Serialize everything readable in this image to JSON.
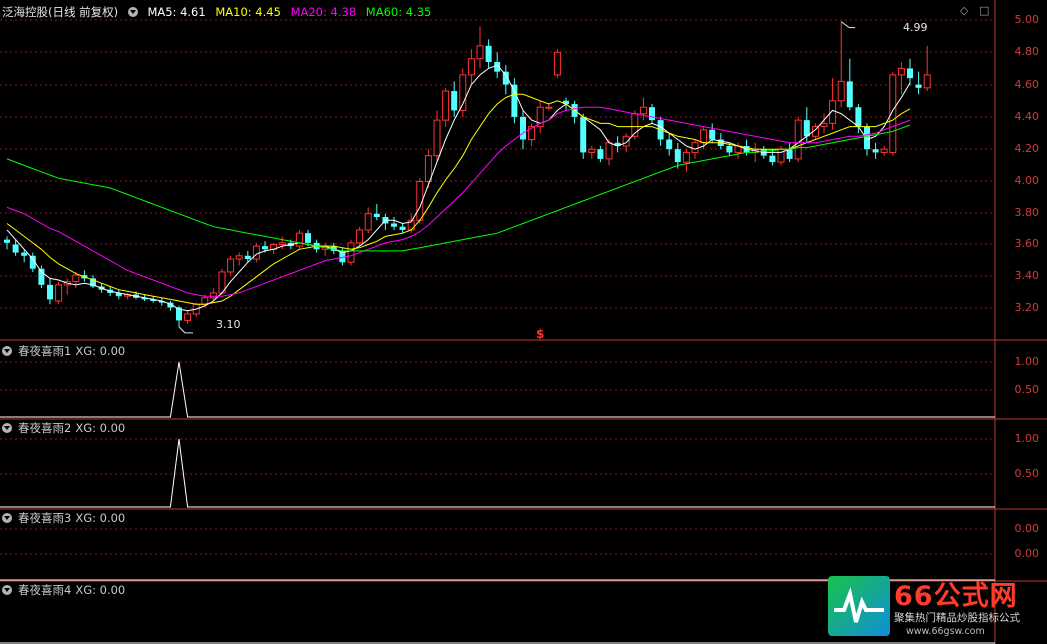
{
  "main": {
    "title": "泛海控股(日线 前复权)",
    "ma_labels": [
      {
        "label": "MA5: 4.61",
        "color": "#ffffff"
      },
      {
        "label": "MA10: 4.45",
        "color": "#ffff00"
      },
      {
        "label": "MA20: 4.38",
        "color": "#ff00ff"
      },
      {
        "label": "MA60: 4.35",
        "color": "#00ff00"
      }
    ],
    "high_label": "4.99",
    "low_label": "3.10",
    "signal_marker": "$",
    "y_ticks": [
      "5.00",
      "4.80",
      "4.60",
      "4.40",
      "4.20",
      "4.00",
      "3.80",
      "3.60",
      "3.40",
      "3.20"
    ]
  },
  "panels": [
    {
      "title": "春夜喜雨1",
      "value_label": "XG: 0.00",
      "ticks": [
        "1.00",
        "0.50"
      ]
    },
    {
      "title": "春夜喜雨2",
      "value_label": "XG: 0.00",
      "ticks": [
        "1.00",
        "0.50"
      ]
    },
    {
      "title": "春夜喜雨3",
      "value_label": "XG: 0.00",
      "ticks": [
        "0.00",
        "0.00"
      ]
    },
    {
      "title": "春夜喜雨4",
      "value_label": "XG: 0.00",
      "ticks": []
    }
  ],
  "window_icons": [
    "diamond-icon",
    "square-icon"
  ],
  "watermark": {
    "title": "66公式网",
    "subtitle": "聚集热门精品炒股指标公式",
    "url": "www.66gsw.com"
  },
  "colors": {
    "up": "#ff3232",
    "down": "#54ffff",
    "grid": "#8b1a1a",
    "axis": "#c83232",
    "ma5": "#ffffff",
    "ma10": "#ffff00",
    "ma20": "#ff00ff",
    "ma60": "#00ff00"
  },
  "chart_data": [
    {
      "type": "candlestick",
      "title": "泛海控股(日线 前复权)",
      "ylim": [
        3.05,
        5.05
      ],
      "ohlc": [
        [
          3.64,
          3.66,
          3.58,
          3.62
        ],
        [
          3.61,
          3.64,
          3.54,
          3.56
        ],
        [
          3.56,
          3.58,
          3.5,
          3.54
        ],
        [
          3.54,
          3.56,
          3.44,
          3.46
        ],
        [
          3.46,
          3.48,
          3.34,
          3.36
        ],
        [
          3.36,
          3.4,
          3.24,
          3.27
        ],
        [
          3.26,
          3.38,
          3.24,
          3.36
        ],
        [
          3.36,
          3.4,
          3.3,
          3.38
        ],
        [
          3.38,
          3.44,
          3.34,
          3.42
        ],
        [
          3.42,
          3.45,
          3.38,
          3.4
        ],
        [
          3.4,
          3.42,
          3.34,
          3.35
        ],
        [
          3.35,
          3.37,
          3.31,
          3.33
        ],
        [
          3.33,
          3.35,
          3.29,
          3.31
        ],
        [
          3.31,
          3.33,
          3.27,
          3.29
        ],
        [
          3.29,
          3.31,
          3.27,
          3.3
        ],
        [
          3.3,
          3.32,
          3.27,
          3.28
        ],
        [
          3.28,
          3.3,
          3.26,
          3.27
        ],
        [
          3.27,
          3.29,
          3.25,
          3.26
        ],
        [
          3.26,
          3.28,
          3.23,
          3.25
        ],
        [
          3.25,
          3.26,
          3.2,
          3.22
        ],
        [
          3.22,
          3.23,
          3.1,
          3.14
        ],
        [
          3.14,
          3.2,
          3.12,
          3.18
        ],
        [
          3.18,
          3.25,
          3.16,
          3.24
        ],
        [
          3.24,
          3.3,
          3.22,
          3.28
        ],
        [
          3.28,
          3.34,
          3.26,
          3.31
        ],
        [
          3.31,
          3.46,
          3.3,
          3.44
        ],
        [
          3.44,
          3.54,
          3.42,
          3.52
        ],
        [
          3.52,
          3.56,
          3.48,
          3.54
        ],
        [
          3.54,
          3.57,
          3.5,
          3.52
        ],
        [
          3.52,
          3.62,
          3.5,
          3.6
        ],
        [
          3.6,
          3.63,
          3.56,
          3.58
        ],
        [
          3.58,
          3.62,
          3.55,
          3.61
        ],
        [
          3.61,
          3.66,
          3.58,
          3.62
        ],
        [
          3.62,
          3.64,
          3.58,
          3.6
        ],
        [
          3.6,
          3.7,
          3.58,
          3.68
        ],
        [
          3.68,
          3.7,
          3.6,
          3.62
        ],
        [
          3.62,
          3.64,
          3.56,
          3.58
        ],
        [
          3.58,
          3.62,
          3.54,
          3.6
        ],
        [
          3.6,
          3.62,
          3.55,
          3.57
        ],
        [
          3.57,
          3.59,
          3.48,
          3.5
        ],
        [
          3.5,
          3.64,
          3.48,
          3.62
        ],
        [
          3.62,
          3.72,
          3.6,
          3.7
        ],
        [
          3.7,
          3.84,
          3.68,
          3.8
        ],
        [
          3.8,
          3.86,
          3.76,
          3.78
        ],
        [
          3.78,
          3.8,
          3.7,
          3.74
        ],
        [
          3.74,
          3.78,
          3.7,
          3.72
        ],
        [
          3.72,
          3.74,
          3.68,
          3.7
        ],
        [
          3.7,
          3.8,
          3.68,
          3.76
        ],
        [
          3.76,
          4.02,
          3.74,
          4.0
        ],
        [
          4.0,
          4.2,
          3.96,
          4.16
        ],
        [
          4.16,
          4.44,
          4.12,
          4.38
        ],
        [
          4.38,
          4.58,
          4.34,
          4.56
        ],
        [
          4.56,
          4.62,
          4.4,
          4.44
        ],
        [
          4.44,
          4.7,
          4.4,
          4.66
        ],
        [
          4.66,
          4.82,
          4.6,
          4.76
        ],
        [
          4.76,
          4.96,
          4.7,
          4.84
        ],
        [
          4.84,
          4.88,
          4.7,
          4.74
        ],
        [
          4.74,
          4.8,
          4.64,
          4.68
        ],
        [
          4.68,
          4.72,
          4.54,
          4.6
        ],
        [
          4.6,
          4.64,
          4.36,
          4.4
        ],
        [
          4.4,
          4.44,
          4.2,
          4.26
        ],
        [
          4.26,
          4.36,
          4.22,
          4.34
        ],
        [
          4.34,
          4.5,
          4.3,
          4.46
        ],
        [
          4.46,
          4.48,
          4.44,
          4.46
        ],
        [
          4.66,
          4.82,
          4.64,
          4.8
        ],
        [
          4.5,
          4.52,
          4.44,
          4.48
        ],
        [
          4.48,
          4.5,
          4.36,
          4.4
        ],
        [
          4.4,
          4.42,
          4.14,
          4.18
        ],
        [
          4.18,
          4.22,
          4.14,
          4.2
        ],
        [
          4.2,
          4.22,
          4.12,
          4.14
        ],
        [
          4.14,
          4.26,
          4.1,
          4.24
        ],
        [
          4.24,
          4.28,
          4.18,
          4.22
        ],
        [
          4.22,
          4.3,
          4.18,
          4.28
        ],
        [
          4.28,
          4.44,
          4.26,
          4.42
        ],
        [
          4.42,
          4.52,
          4.38,
          4.46
        ],
        [
          4.46,
          4.48,
          4.36,
          4.38
        ],
        [
          4.38,
          4.4,
          4.22,
          4.26
        ],
        [
          4.26,
          4.3,
          4.16,
          4.2
        ],
        [
          4.2,
          4.24,
          4.08,
          4.12
        ],
        [
          4.12,
          4.2,
          4.06,
          4.18
        ],
        [
          4.18,
          4.26,
          4.14,
          4.24
        ],
        [
          4.24,
          4.34,
          4.2,
          4.32
        ],
        [
          4.32,
          4.36,
          4.24,
          4.26
        ],
        [
          4.26,
          4.3,
          4.2,
          4.22
        ],
        [
          4.22,
          4.24,
          4.16,
          4.18
        ],
        [
          4.18,
          4.24,
          4.14,
          4.22
        ],
        [
          4.22,
          4.26,
          4.16,
          4.18
        ],
        [
          4.18,
          4.24,
          4.12,
          4.2
        ],
        [
          4.2,
          4.22,
          4.14,
          4.16
        ],
        [
          4.16,
          4.2,
          4.1,
          4.12
        ],
        [
          4.12,
          4.22,
          4.1,
          4.2
        ],
        [
          4.2,
          4.24,
          4.12,
          4.14
        ],
        [
          4.14,
          4.4,
          4.12,
          4.38
        ],
        [
          4.38,
          4.46,
          4.24,
          4.28
        ],
        [
          4.28,
          4.36,
          4.26,
          4.34
        ],
        [
          4.34,
          4.42,
          4.3,
          4.36
        ],
        [
          4.36,
          4.64,
          4.32,
          4.5
        ],
        [
          4.5,
          4.99,
          4.46,
          4.62
        ],
        [
          4.62,
          4.76,
          4.44,
          4.46
        ],
        [
          4.46,
          4.48,
          4.3,
          4.34
        ],
        [
          4.34,
          4.36,
          4.16,
          4.2
        ],
        [
          4.2,
          4.24,
          4.14,
          4.18
        ],
        [
          4.18,
          4.22,
          4.16,
          4.2
        ],
        [
          4.18,
          4.68,
          4.16,
          4.66
        ],
        [
          4.66,
          4.74,
          4.54,
          4.7
        ],
        [
          4.7,
          4.76,
          4.6,
          4.64
        ],
        [
          4.6,
          4.68,
          4.54,
          4.58
        ],
        [
          4.58,
          4.84,
          4.56,
          4.66
        ]
      ],
      "ma": {
        "MA5": [
          3.7,
          3.64,
          3.58,
          3.52,
          3.44,
          3.4,
          3.39,
          3.37,
          3.36,
          3.37,
          3.36,
          3.34,
          3.32,
          3.31,
          3.3,
          3.29,
          3.28,
          3.27,
          3.26,
          3.24,
          3.21,
          3.2,
          3.21,
          3.23,
          3.26,
          3.31,
          3.38,
          3.44,
          3.5,
          3.55,
          3.57,
          3.58,
          3.6,
          3.61,
          3.62,
          3.61,
          3.6,
          3.6,
          3.58,
          3.56,
          3.57,
          3.6,
          3.64,
          3.7,
          3.76,
          3.76,
          3.74,
          3.75,
          3.84,
          3.98,
          4.12,
          4.26,
          4.38,
          4.48,
          4.6,
          4.66,
          4.7,
          4.72,
          4.66,
          4.56,
          4.44,
          4.38,
          4.36,
          4.38,
          4.44,
          4.48,
          4.44,
          4.4,
          4.36,
          4.32,
          4.24,
          4.22,
          4.24,
          4.3,
          4.34,
          4.36,
          4.34,
          4.3,
          4.26,
          4.22,
          4.2,
          4.22,
          4.26,
          4.25,
          4.24,
          4.22,
          4.2,
          4.19,
          4.18,
          4.18,
          4.18,
          4.2,
          4.24,
          4.28,
          4.32,
          4.38,
          4.44,
          4.42,
          4.38,
          4.34,
          4.26,
          4.28,
          4.34,
          4.44,
          4.52,
          4.61
        ],
        "MA10": [
          3.74,
          3.7,
          3.66,
          3.62,
          3.58,
          3.53,
          3.49,
          3.46,
          3.43,
          3.41,
          3.39,
          3.37,
          3.35,
          3.33,
          3.32,
          3.31,
          3.3,
          3.29,
          3.28,
          3.27,
          3.26,
          3.25,
          3.24,
          3.24,
          3.25,
          3.26,
          3.29,
          3.33,
          3.37,
          3.41,
          3.45,
          3.49,
          3.52,
          3.55,
          3.58,
          3.59,
          3.6,
          3.6,
          3.6,
          3.59,
          3.58,
          3.59,
          3.61,
          3.63,
          3.66,
          3.67,
          3.68,
          3.7,
          3.76,
          3.84,
          3.93,
          4.01,
          4.08,
          4.16,
          4.26,
          4.34,
          4.42,
          4.48,
          4.52,
          4.54,
          4.54,
          4.52,
          4.5,
          4.48,
          4.5,
          4.48,
          4.44,
          4.4,
          4.38,
          4.36,
          4.36,
          4.34,
          4.34,
          4.34,
          4.34,
          4.34,
          4.32,
          4.3,
          4.28,
          4.27,
          4.26,
          4.24,
          4.24,
          4.24,
          4.23,
          4.22,
          4.21,
          4.2,
          4.2,
          4.2,
          4.2,
          4.2,
          4.22,
          4.24,
          4.26,
          4.28,
          4.3,
          4.32,
          4.34,
          4.34,
          4.34,
          4.34,
          4.36,
          4.38,
          4.42,
          4.45
        ],
        "MA20": [
          3.84,
          3.82,
          3.8,
          3.77,
          3.74,
          3.71,
          3.69,
          3.66,
          3.63,
          3.6,
          3.57,
          3.54,
          3.51,
          3.48,
          3.45,
          3.43,
          3.41,
          3.39,
          3.37,
          3.35,
          3.33,
          3.31,
          3.3,
          3.29,
          3.29,
          3.29,
          3.3,
          3.31,
          3.33,
          3.35,
          3.37,
          3.39,
          3.41,
          3.43,
          3.45,
          3.47,
          3.49,
          3.51,
          3.52,
          3.53,
          3.54,
          3.56,
          3.58,
          3.6,
          3.62,
          3.63,
          3.64,
          3.66,
          3.69,
          3.73,
          3.78,
          3.83,
          3.88,
          3.93,
          3.99,
          4.05,
          4.11,
          4.17,
          4.22,
          4.26,
          4.3,
          4.33,
          4.36,
          4.38,
          4.42,
          4.44,
          4.45,
          4.46,
          4.46,
          4.46,
          4.45,
          4.44,
          4.43,
          4.42,
          4.41,
          4.4,
          4.39,
          4.38,
          4.37,
          4.36,
          4.35,
          4.34,
          4.33,
          4.32,
          4.31,
          4.3,
          4.29,
          4.28,
          4.27,
          4.26,
          4.25,
          4.24,
          4.24,
          4.24,
          4.24,
          4.25,
          4.26,
          4.27,
          4.28,
          4.28,
          4.29,
          4.3,
          4.32,
          4.34,
          4.36,
          4.38
        ],
        "MA60": [
          4.14,
          4.12,
          4.1,
          4.08,
          4.06,
          4.04,
          4.02,
          4.01,
          4.0,
          3.99,
          3.98,
          3.97,
          3.96,
          3.94,
          3.92,
          3.9,
          3.88,
          3.86,
          3.84,
          3.82,
          3.8,
          3.78,
          3.76,
          3.74,
          3.72,
          3.71,
          3.7,
          3.69,
          3.68,
          3.67,
          3.66,
          3.65,
          3.64,
          3.63,
          3.62,
          3.61,
          3.6,
          3.59,
          3.58,
          3.57,
          3.57,
          3.57,
          3.57,
          3.57,
          3.57,
          3.57,
          3.57,
          3.58,
          3.59,
          3.6,
          3.61,
          3.62,
          3.63,
          3.64,
          3.65,
          3.66,
          3.67,
          3.68,
          3.7,
          3.72,
          3.74,
          3.76,
          3.78,
          3.8,
          3.82,
          3.84,
          3.86,
          3.88,
          3.9,
          3.92,
          3.94,
          3.96,
          3.98,
          4.0,
          4.02,
          4.04,
          4.06,
          4.08,
          4.1,
          4.11,
          4.12,
          4.13,
          4.14,
          4.15,
          4.16,
          4.17,
          4.18,
          4.18,
          4.19,
          4.19,
          4.2,
          4.2,
          4.21,
          4.21,
          4.22,
          4.23,
          4.24,
          4.25,
          4.26,
          4.27,
          4.28,
          4.29,
          4.3,
          4.31,
          4.33,
          4.35
        ]
      }
    },
    {
      "type": "line",
      "title": "春夜喜雨1",
      "ylim": [
        0,
        1.1
      ],
      "spike_index": 20,
      "value": 1.0
    },
    {
      "type": "line",
      "title": "春夜喜雨2",
      "ylim": [
        0,
        1.1
      ],
      "spike_index": 20,
      "value": 1.0
    },
    {
      "type": "line",
      "title": "春夜喜雨3",
      "ylim": [
        0,
        1
      ],
      "value": 0
    },
    {
      "type": "line",
      "title": "春夜喜雨4",
      "ylim": [
        0,
        1
      ],
      "value": 0
    }
  ]
}
